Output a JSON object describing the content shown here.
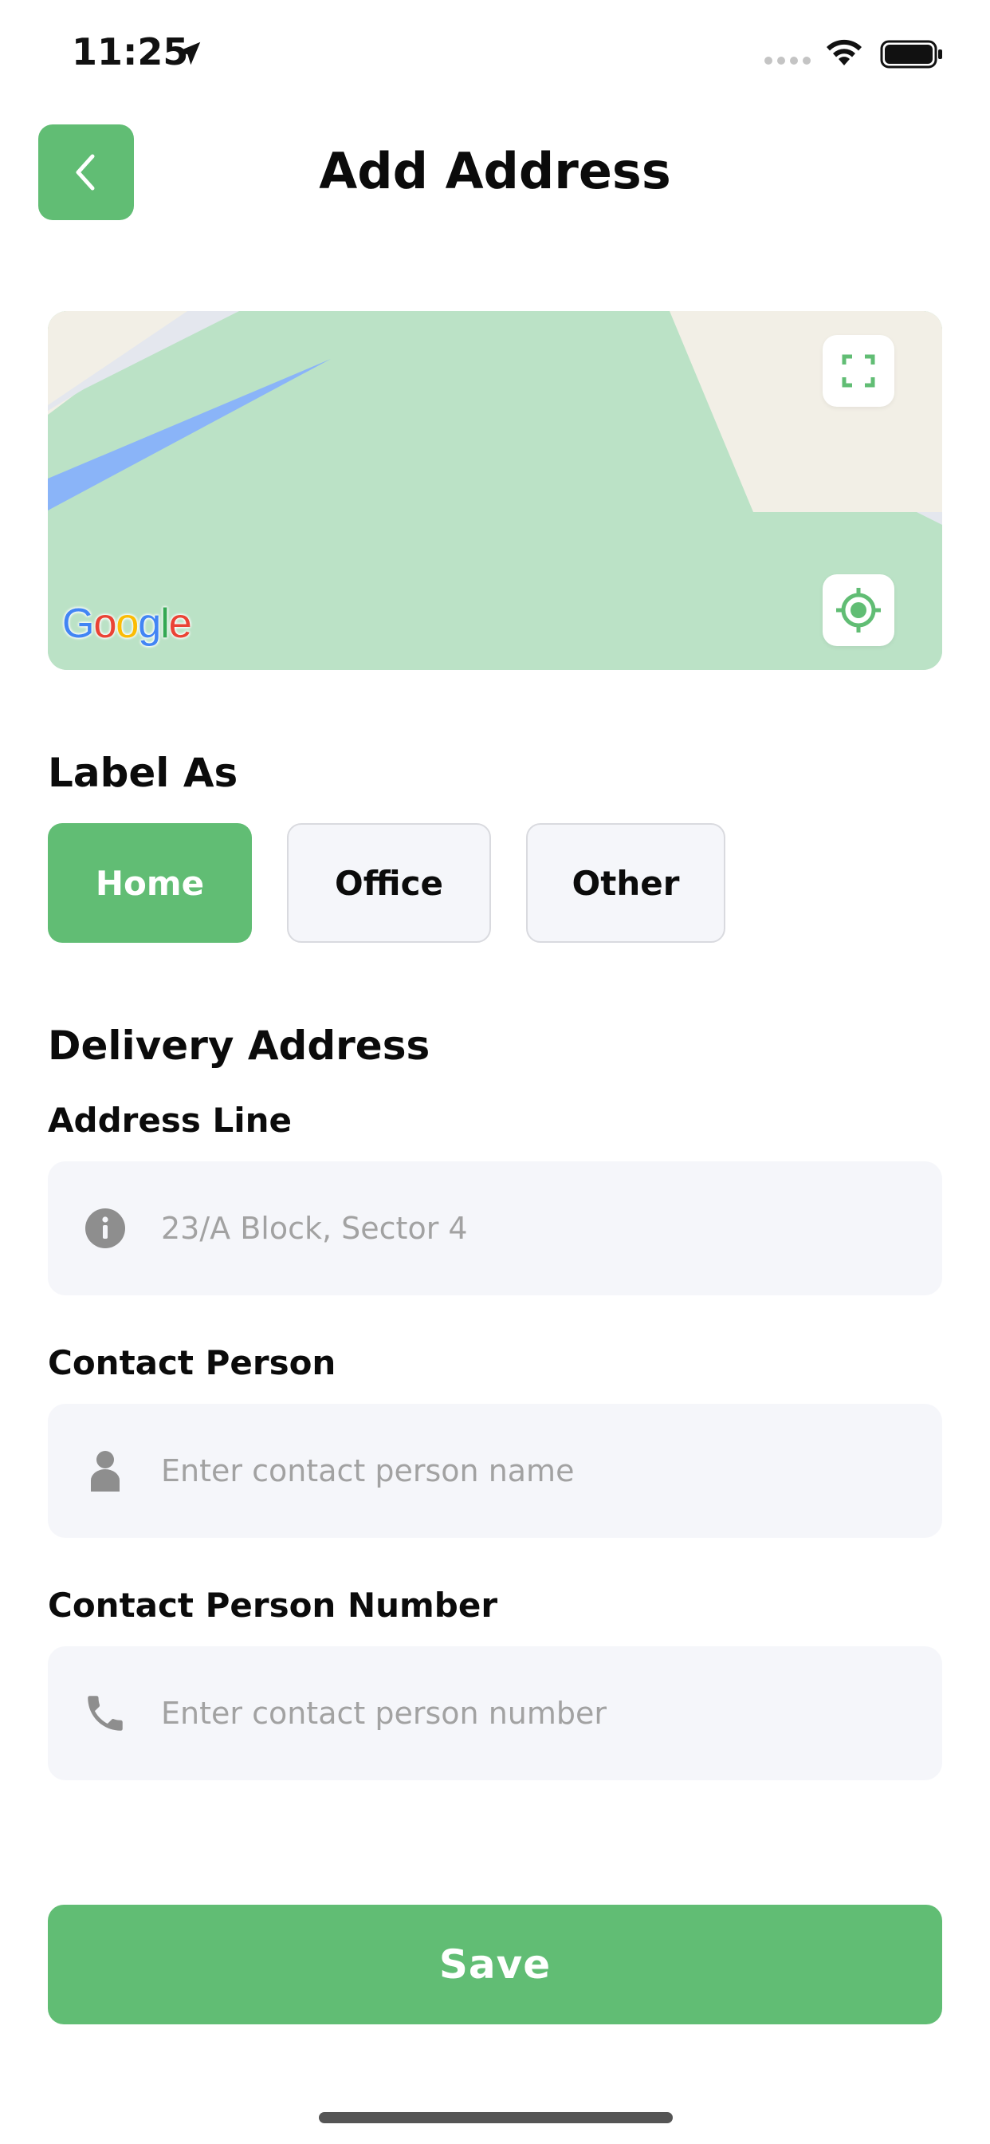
{
  "status_bar": {
    "time": "11:25"
  },
  "header": {
    "title": "Add Address",
    "back_icon": "chevron-left-icon"
  },
  "map": {
    "logo_text": "Google",
    "fullscreen_icon": "fullscreen-icon",
    "locate_icon": "my-location-icon",
    "colors": {
      "park": "#bbe2c6",
      "land": "#f2efe6",
      "water": "#8ab4f8"
    }
  },
  "label_section": {
    "title": "Label As",
    "options": [
      {
        "label": "Home",
        "selected": true
      },
      {
        "label": "Office",
        "selected": false
      },
      {
        "label": "Other",
        "selected": false
      }
    ]
  },
  "delivery": {
    "title": "Delivery Address",
    "fields": [
      {
        "label": "Address Line",
        "value": "23/A Block, Sector 4",
        "placeholder": "",
        "icon": "info-icon"
      },
      {
        "label": "Contact Person",
        "value": "",
        "placeholder": "Enter contact person name",
        "icon": "person-icon"
      },
      {
        "label": "Contact Person Number",
        "value": "",
        "placeholder": "Enter contact person number",
        "icon": "phone-icon"
      }
    ]
  },
  "footer": {
    "save_label": "Save"
  },
  "colors": {
    "accent": "#61bd74",
    "input_bg": "#f5f6fa",
    "placeholder": "#a2a2a2"
  }
}
